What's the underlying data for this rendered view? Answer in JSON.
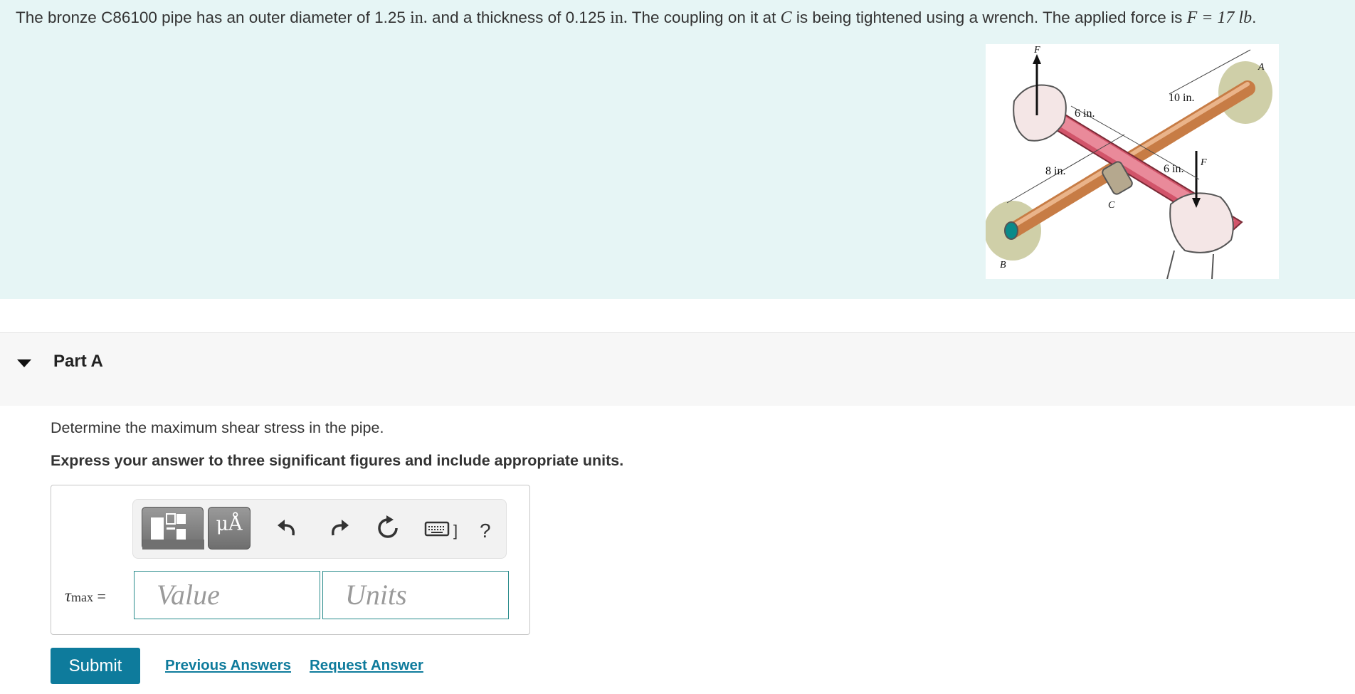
{
  "problem": {
    "text_1": "The bronze C86100 pipe has an outer diameter of 1.25 ",
    "unit_1": "in.",
    "text_2": " and a thickness of 0.125 ",
    "unit_2": "in.",
    "text_3": " The coupling on it at ",
    "point_c": "C",
    "text_4": " is being tightened using a wrench. The applied force is ",
    "force_expr": "F = 17 lb",
    "text_5": "."
  },
  "figure": {
    "labels": {
      "f_top": "F",
      "a": "A",
      "dim_10": "10 in.",
      "dim_6_top": "6 in.",
      "dim_8": "8 in.",
      "dim_6_bottom": "6 in.",
      "f_bottom": "F",
      "c": "C",
      "b": "B"
    }
  },
  "part": {
    "title": "Part A",
    "question": "Determine the maximum shear stress in the pipe.",
    "instruction": "Express your answer to three significant figures and include appropriate units."
  },
  "toolbar": {
    "units_label": "μÅ",
    "help_label": "?",
    "keyboard_suffix": "]"
  },
  "answer": {
    "variable": "τ",
    "subscript": "max",
    "equals": "=",
    "value_placeholder": "Value",
    "units_placeholder": "Units"
  },
  "actions": {
    "submit_label": "Submit",
    "previous_answers_label": "Previous Answers",
    "request_answer_label": "Request Answer"
  }
}
